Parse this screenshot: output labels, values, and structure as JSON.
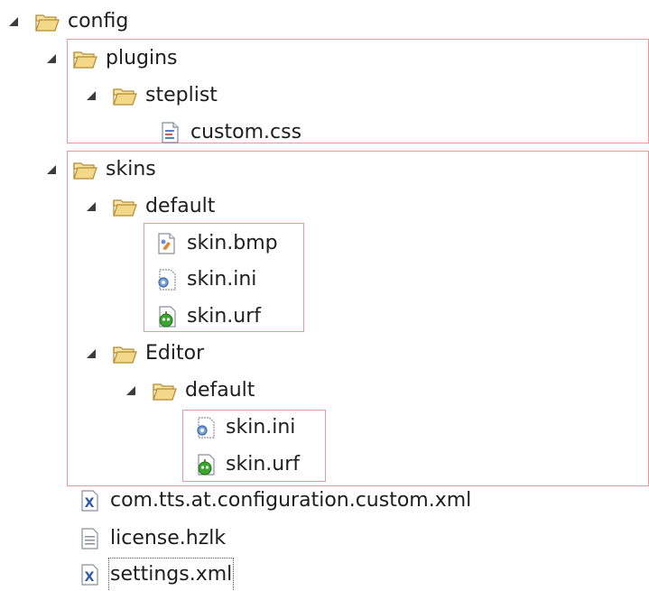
{
  "tree": {
    "config": "config",
    "plugins": "plugins",
    "steplist": "steplist",
    "custom_css": "custom.css",
    "skins": "skins",
    "default1": "default",
    "skin_bmp": "skin.bmp",
    "skin_ini_1": "skin.ini",
    "skin_urf_1": "skin.urf",
    "editor": "Editor",
    "default2": "default",
    "skin_ini_2": "skin.ini",
    "skin_urf_2": "skin.urf",
    "config_xml": "com.tts.at.configuration.custom.xml",
    "license": "license.hzlk",
    "settings": "settings.xml"
  },
  "colors": {
    "highlight_border": "#e79a9c",
    "folder": "#f4d88a",
    "folder_stroke": "#b58a2e",
    "xml_blue": "#2f5aa8",
    "green_apple": "#3aa62f"
  }
}
